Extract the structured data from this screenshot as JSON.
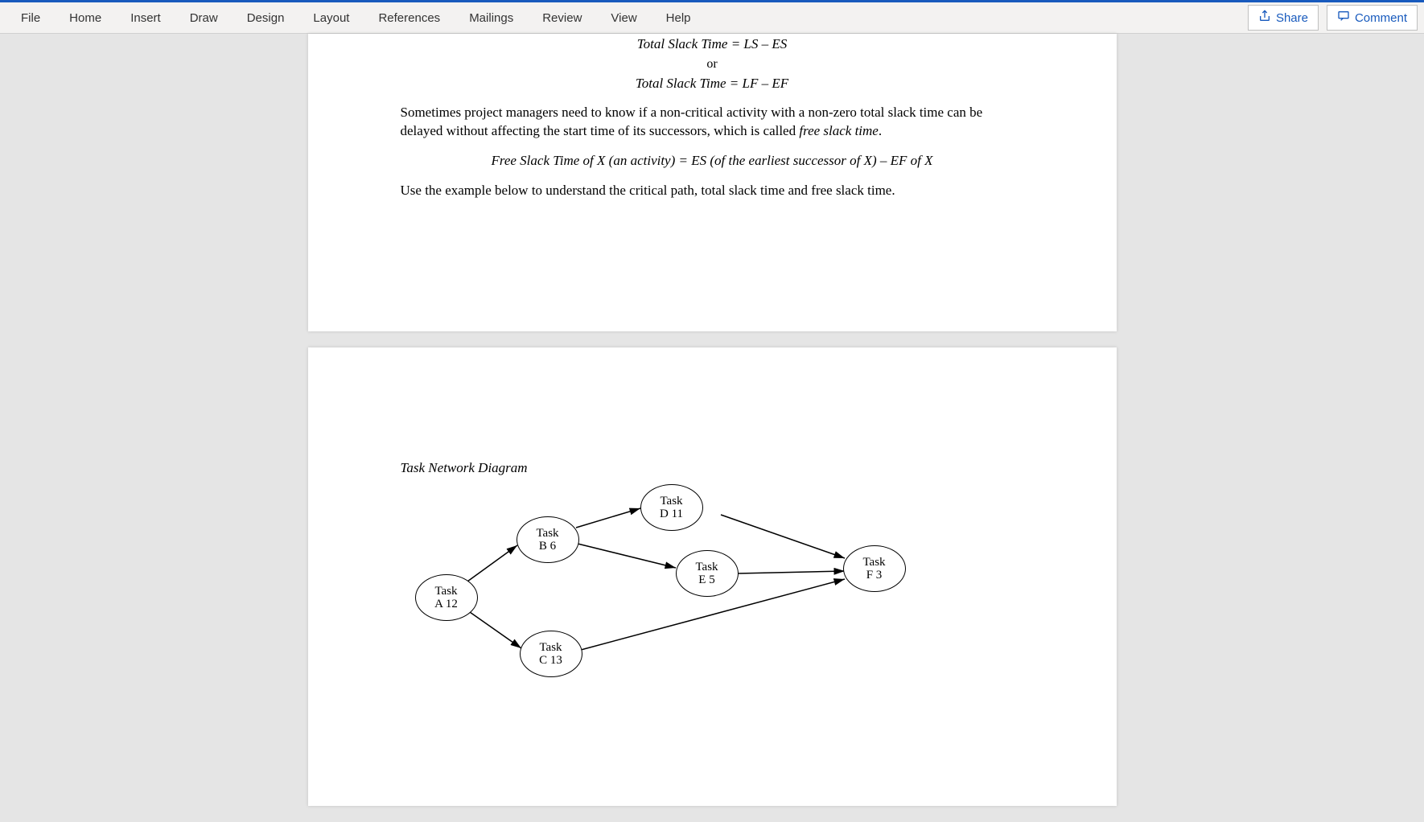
{
  "ribbon": {
    "tabs": [
      "File",
      "Home",
      "Insert",
      "Draw",
      "Design",
      "Layout",
      "References",
      "Mailings",
      "Review",
      "View",
      "Help"
    ],
    "share": "Share",
    "comment": "Comment"
  },
  "doc": {
    "eq1": "Total Slack Time = LS – ES",
    "or": "or",
    "eq2": "Total Slack Time = LF – EF",
    "para1a": "Sometimes project managers need to know if a non-critical activity with a non-zero total slack time can be delayed without affecting the start time of its successors, which is called ",
    "para1b": "free slack time",
    "para1c": ".",
    "eq3": "Free Slack Time of X (an activity) = ES (of the earliest successor of X) – EF of X",
    "para2": "Use the example below to understand the critical path, total slack time and free slack time."
  },
  "diagram": {
    "title": "Task Network Diagram",
    "nodes": {
      "a": {
        "l1": "Task",
        "l2": "A 12"
      },
      "b": {
        "l1": "Task",
        "l2": "B 6"
      },
      "c": {
        "l1": "Task",
        "l2": "C 13"
      },
      "d": {
        "l1": "Task",
        "l2": "D 11"
      },
      "e": {
        "l1": "Task",
        "l2": "E 5"
      },
      "f": {
        "l1": "Task",
        "l2": "F 3"
      }
    }
  }
}
